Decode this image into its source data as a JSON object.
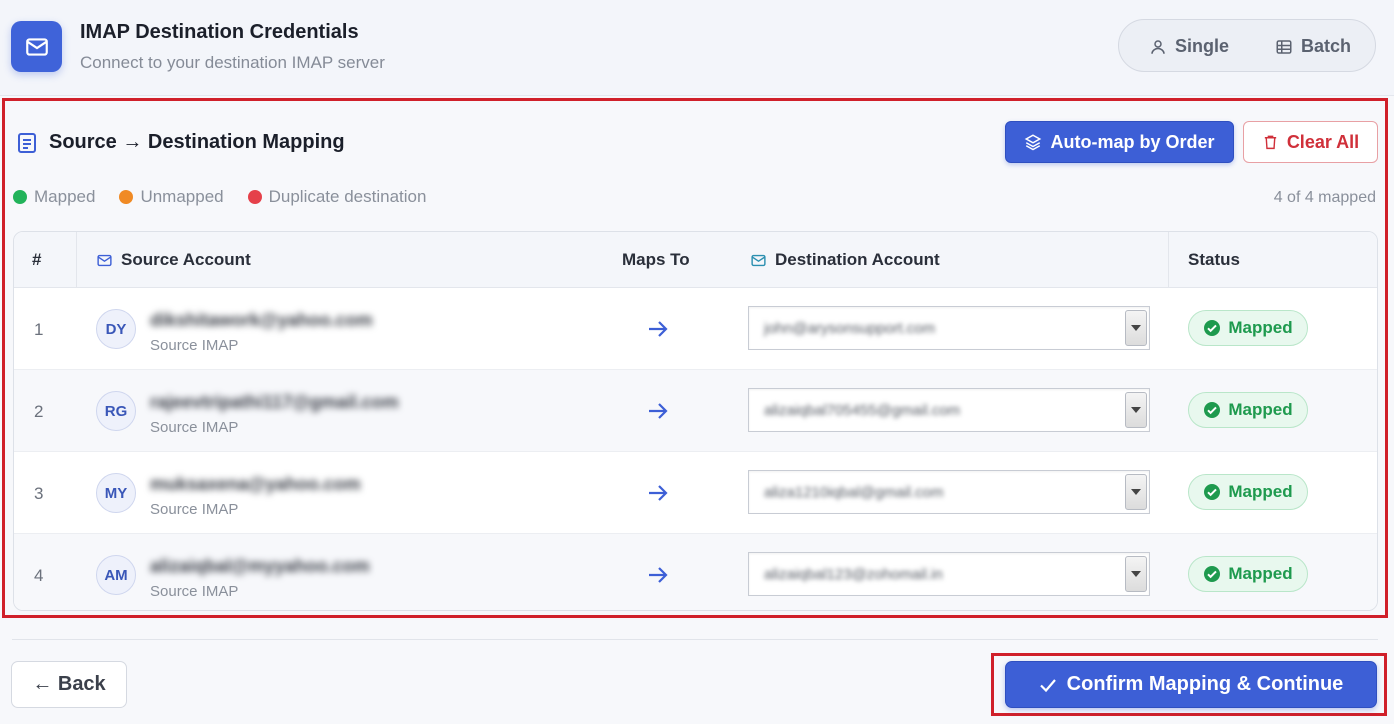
{
  "header": {
    "title": "IMAP Destination Credentials",
    "subtitle": "Connect to your destination IMAP server",
    "mode_single": "Single",
    "mode_batch": "Batch"
  },
  "panel": {
    "title": "Source → Destination Mapping",
    "automap_label": "Auto-map by Order",
    "clear_label": "Clear All",
    "legend": {
      "mapped": "Mapped",
      "unmapped": "Unmapped",
      "duplicate": "Duplicate destination"
    },
    "mapped_count": "4 of 4 mapped"
  },
  "table": {
    "headers": {
      "num": "#",
      "source": "Source Account",
      "maps_to": "Maps To",
      "destination": "Destination Account",
      "status": "Status"
    },
    "rows": [
      {
        "num": "1",
        "initials": "DY",
        "source_email": "dikshitawork@yahoo.com",
        "source_type": "Source IMAP",
        "destination": "john@arysonsupport.com",
        "status": "Mapped"
      },
      {
        "num": "2",
        "initials": "RG",
        "source_email": "rajeevtripathi117@gmail.com",
        "source_type": "Source IMAP",
        "destination": "alizaiqbal705455@gmail.com",
        "status": "Mapped"
      },
      {
        "num": "3",
        "initials": "MY",
        "source_email": "muksaxena@yahoo.com",
        "source_type": "Source IMAP",
        "destination": "aliza1210iqbal@gmail.com",
        "status": "Mapped"
      },
      {
        "num": "4",
        "initials": "AM",
        "source_email": "alizaiqbal@myyahoo.com",
        "source_type": "Source IMAP",
        "destination": "alizaiqbal123@zohomail.in",
        "status": "Mapped"
      }
    ]
  },
  "footer": {
    "back_label": "← Back",
    "confirm_label": "Confirm Mapping & Continue"
  },
  "colors": {
    "accent": "#3d5fd6",
    "mapped": "#22b35a",
    "unmapped": "#f08a24",
    "duplicate": "#e5404a",
    "highlight": "#d0202a"
  }
}
